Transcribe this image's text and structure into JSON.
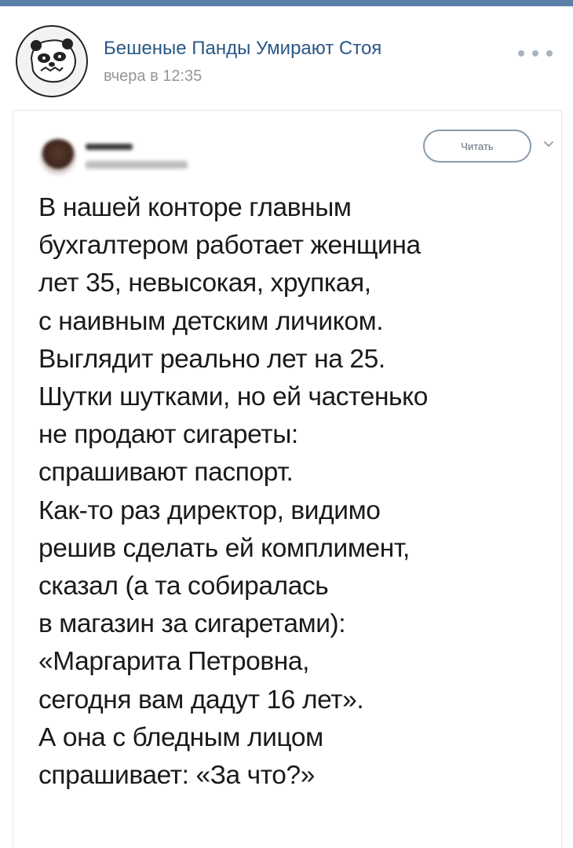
{
  "post": {
    "community_name": "Бешеные Панды Умирают Стоя",
    "time": "вчера в 12:35",
    "more_icon": "ellipsis-icon"
  },
  "tweet": {
    "follow_label": "Читать",
    "lines": [
      "В нашей конторе главным",
      "бухгалтером работает женщина",
      "лет 35, невысокая, хрупкая,",
      "с наивным детским личиком.",
      "Выглядит реально лет на 25.",
      "Шутки шутками, но ей частенько",
      "не продают сигареты:",
      "спрашивают паспорт.",
      "Как-то раз директор, видимо",
      "решив сделать ей комплимент,",
      "сказал (а та собиралась",
      "в магазин за сигаретами):",
      "«Маргарита Петровна,",
      "сегодня вам дадут 16 лет».",
      "А она с бледным лицом",
      "спрашивает: «За что?»"
    ]
  },
  "colors": {
    "topbar": "#5b7fa8",
    "link": "#2a5885",
    "muted": "#939699"
  }
}
